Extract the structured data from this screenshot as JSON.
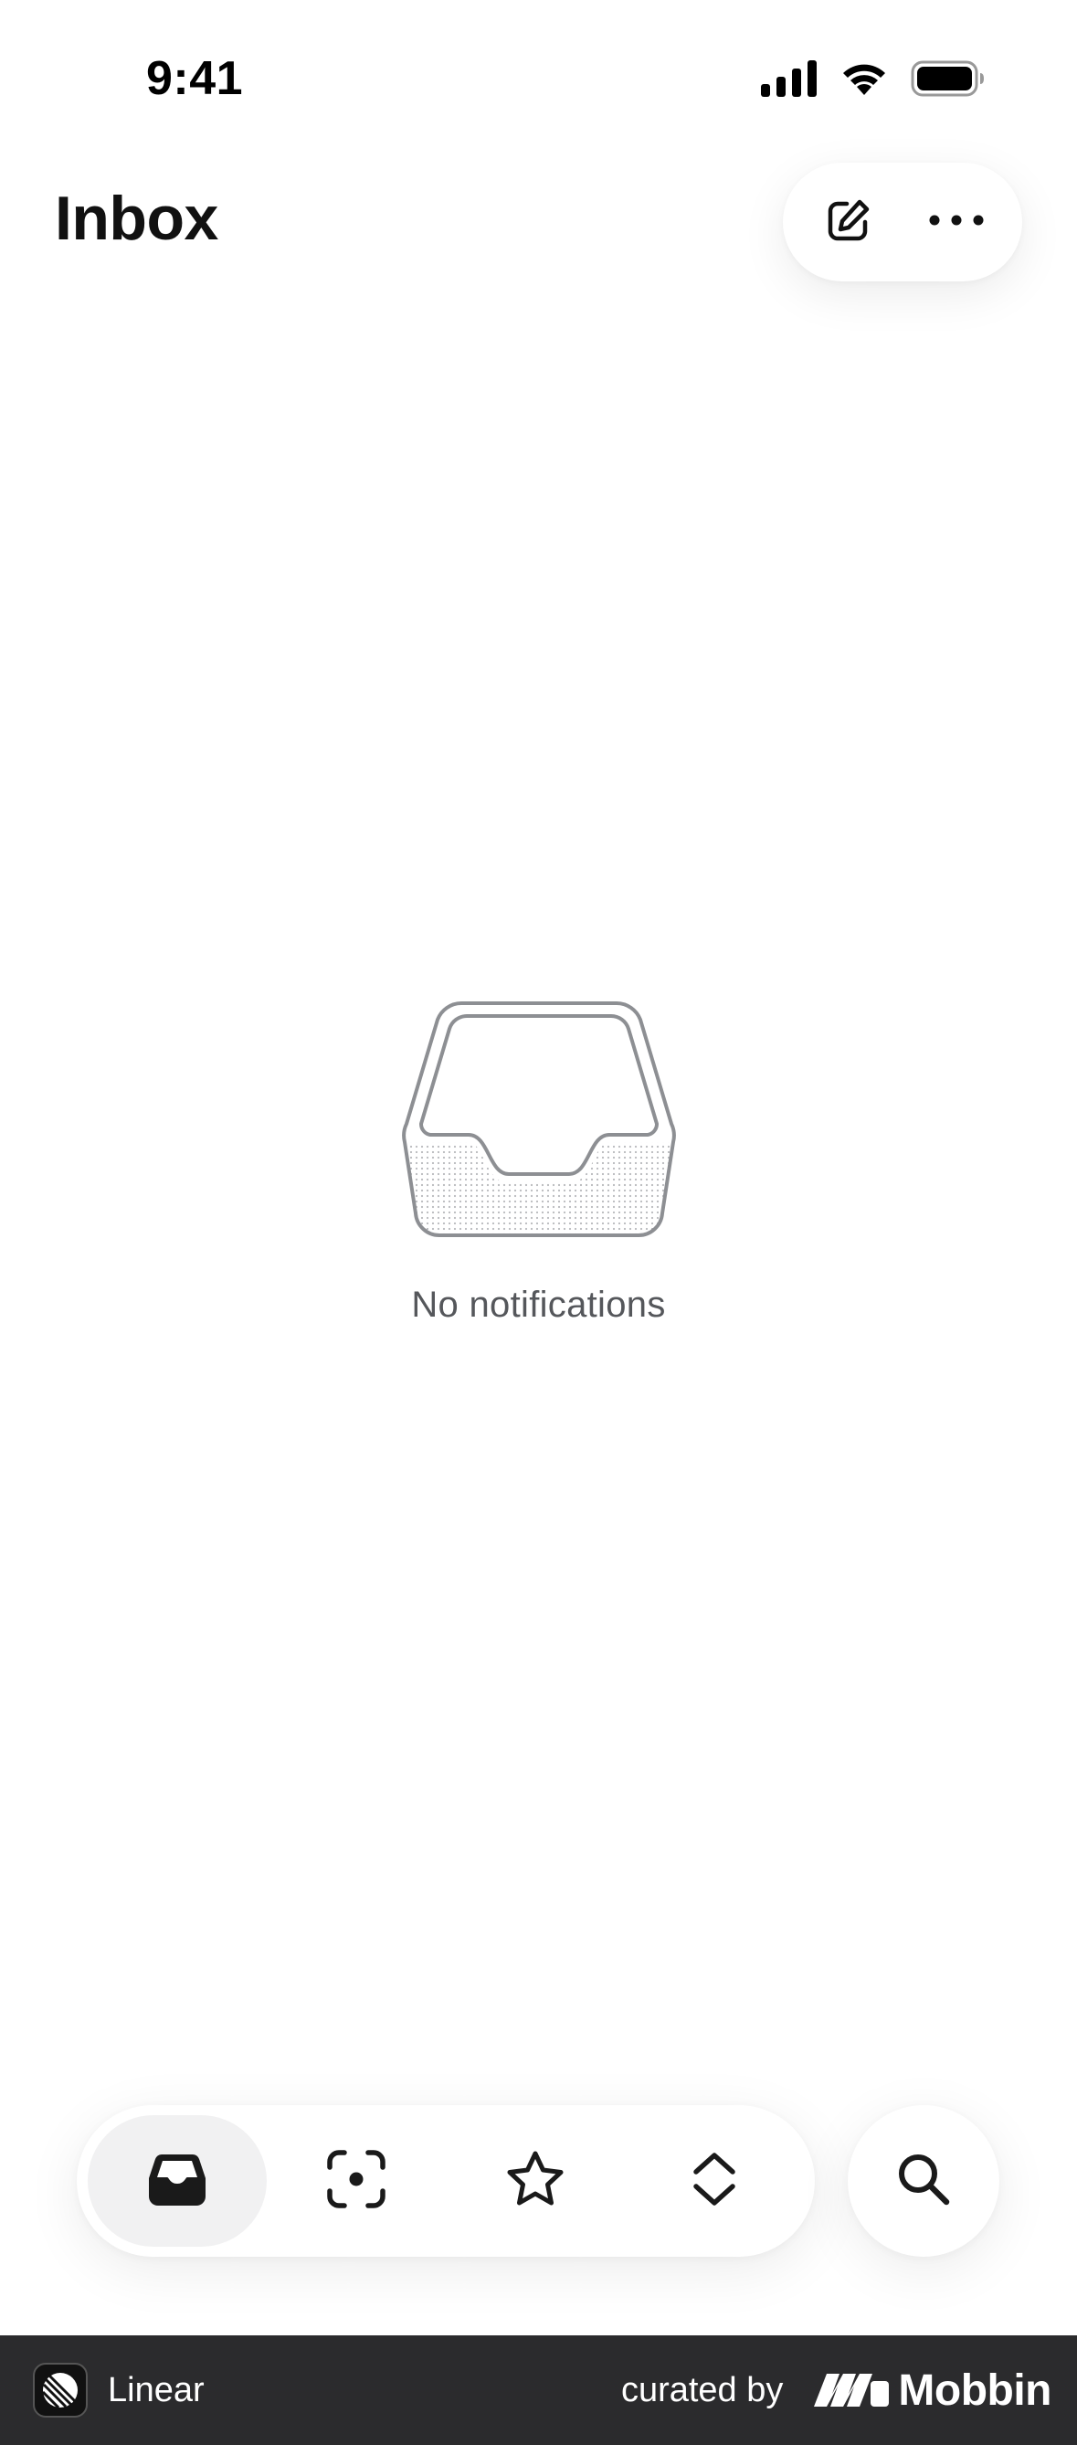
{
  "status_bar": {
    "time": "9:41",
    "icons": [
      "cellular-signal-icon",
      "wifi-icon",
      "battery-icon"
    ]
  },
  "header": {
    "title": "Inbox",
    "actions": [
      "compose-icon",
      "more-icon"
    ]
  },
  "empty_state": {
    "illustration": "empty-inbox-tray",
    "message": "No notifications"
  },
  "tab_bar": {
    "tabs": [
      {
        "icon": "inbox-icon",
        "active": true
      },
      {
        "icon": "focus-icon",
        "active": false
      },
      {
        "icon": "star-icon",
        "active": false
      },
      {
        "icon": "chevron-up-down-icon",
        "active": false
      }
    ],
    "search": "search-icon"
  },
  "footer": {
    "app_name": "Linear",
    "curated_label": "curated by",
    "brand_name": "Mobbin"
  },
  "colors": {
    "background": "#ffffff",
    "text": "#111111",
    "muted_text": "#55575b",
    "active_tab": "#f1f1f2",
    "footer_bg": "#2b2b2d"
  }
}
